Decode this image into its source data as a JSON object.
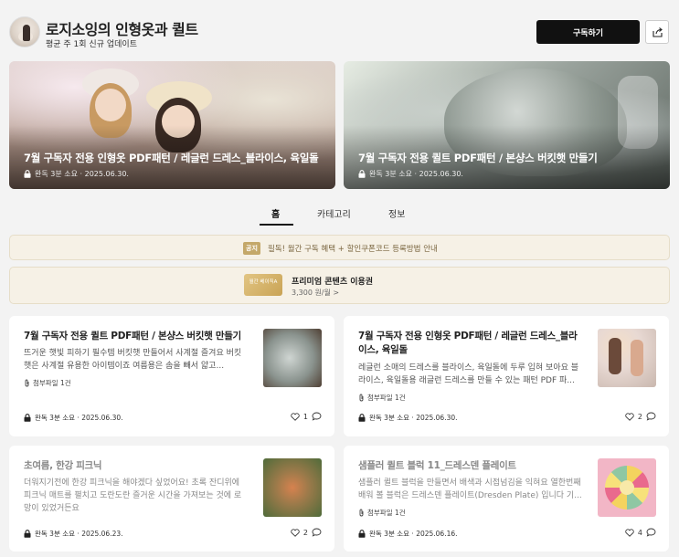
{
  "header": {
    "title": "로지소잉의 인형옷과 퀼트",
    "subtitle": "평균 주 1회 신규 업데이트",
    "subscribe_label": "구독하기"
  },
  "banners": [
    {
      "title": "7월 구독자 전용 인형옷 PDF패턴 / 레글런 드레스_블라이스, 육일돌",
      "meta": "완독 3분 소요 · 2025.06.30."
    },
    {
      "title": "7월 구독자 전용 퀼트 PDF패턴 / 본샹스 버킷햇 만들기",
      "meta": "완독 3분 소요 · 2025.06.30."
    }
  ],
  "tabs": [
    {
      "label": "홈",
      "active": true
    },
    {
      "label": "카테고리",
      "active": false
    },
    {
      "label": "정보",
      "active": false
    }
  ],
  "notice": {
    "badge": "공지",
    "text": "필독! 월간 구독 혜택 + 할인쿠폰코드 등록방법 안내"
  },
  "premium": {
    "card_label": "월간 베이직A",
    "title": "프리미엄 콘텐츠 이용권",
    "price": "3,300 원/월 >"
  },
  "posts": [
    {
      "title": "7월 구독자 전용 퀼트 PDF패턴 / 본샹스 버킷햇 만들기",
      "desc": "뜨거운 햇빛 피하기 필수템 버킷햇 만들어서 사계절 즐겨요 버킷햇은 사계절 유용한 아이템이죠 여름용은 솜을 빼서 얇고...",
      "attach": "첨부파일 1건",
      "meta": "완독 3분 소요 · 2025.06.30.",
      "likes": "1"
    },
    {
      "title": "7월 구독자 전용 인형옷 PDF패턴 / 레글런 드레스_블라이스, 육일돌",
      "desc": "레글런 소매의 드레스를 블라이스, 육일돌에 두루 입혀 보아요 블라이스, 육일돌용 래글런 드레스를 만들 수 있는 패턴 PDF 파...",
      "attach": "첨부파일 1건",
      "meta": "완독 3분 소요 · 2025.06.30.",
      "likes": "2"
    },
    {
      "title": "초여름, 한강 피크닉",
      "desc": "더워지기전에 한강 피크닉을 해야겠다 싶었어요! 초록 잔디위에 피크닉 매트를 펼치고 도란도란 즐거운 시간을 가져보는 것에 로망이 있었거든요",
      "attach": "",
      "meta": "완독 3분 소요 · 2025.06.23.",
      "likes": "2"
    },
    {
      "title": "샘플러 퀼트 블럭 11_드레스덴 플레이트",
      "desc": "샘플러 퀼트 블럭을 만들면서 배색과 시접넘김을 익혀요 열한번째 배워 볼 블럭은 드레스덴 플레이트(Dresden Plate) 입니다 기...",
      "attach": "첨부파일 1건",
      "meta": "완독 3분 소요 · 2025.06.16.",
      "likes": "4"
    }
  ]
}
